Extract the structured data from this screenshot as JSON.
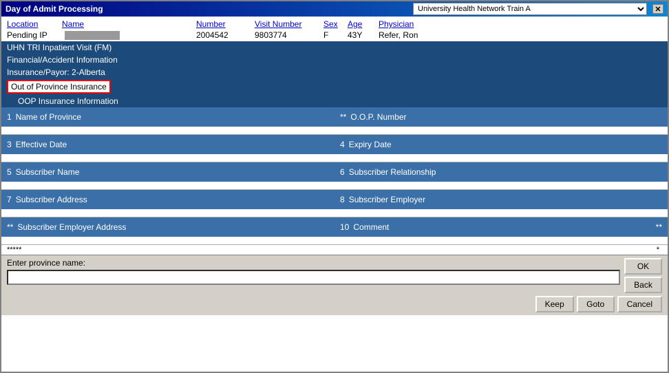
{
  "window": {
    "title": "Day of Admit Processing",
    "close_label": "✕"
  },
  "top_select": {
    "value": "University Health Network Train A",
    "options": [
      "University Health Network Train A"
    ]
  },
  "header": {
    "location_label": "Location",
    "name_label": "Name",
    "number_label": "Number",
    "visit_number_label": "Visit Number",
    "sex_label": "Sex",
    "age_label": "Age",
    "physician_label": "Physician"
  },
  "patient": {
    "location": "Pending IP",
    "name": "",
    "number": "2004542",
    "visit_number": "9803774",
    "sex": "F",
    "age": "43Y",
    "physician": "Refer, Ron"
  },
  "menu": {
    "items": [
      {
        "label": "UHN TRI Inpatient Visit (FM)",
        "indent": false
      },
      {
        "label": "Financial/Accident Information",
        "indent": false
      },
      {
        "label": "Insurance/Payor:  2-Alberta",
        "indent": false
      }
    ],
    "highlighted": "Out of Province Insurance",
    "sub_label": "OOP Insurance Information"
  },
  "form": {
    "fields": [
      {
        "row": 1,
        "left": {
          "num": "1",
          "label": "Name of Province",
          "required": "**"
        },
        "right": {
          "num": "**",
          "label": "O.O.P. Number",
          "required": ""
        }
      },
      {
        "row": 2,
        "left": {
          "num": "3",
          "label": "Effective Date",
          "required": ""
        },
        "right": {
          "num": "4",
          "label": "Expiry Date",
          "required": ""
        }
      },
      {
        "row": 3,
        "left": {
          "num": "5",
          "label": "Subscriber Name",
          "required": ""
        },
        "right": {
          "num": "6",
          "label": "Subscriber Relationship",
          "required": ""
        }
      },
      {
        "row": 4,
        "left": {
          "num": "7",
          "label": "Subscriber Address",
          "required": ""
        },
        "right": {
          "num": "8",
          "label": "Subscriber Employer",
          "required": ""
        }
      },
      {
        "row": 5,
        "left": {
          "num": "**",
          "label": "Subscriber Employer Address",
          "required": ""
        },
        "right": {
          "num": "10",
          "label": "Comment",
          "required": "**"
        }
      }
    ],
    "stars_left": "*****",
    "stars_right": "*"
  },
  "prompt": {
    "label": "Enter province name:",
    "placeholder": ""
  },
  "buttons": {
    "ok": "OK",
    "back": "Back",
    "keep": "Keep",
    "goto": "Goto",
    "cancel": "Cancel"
  }
}
